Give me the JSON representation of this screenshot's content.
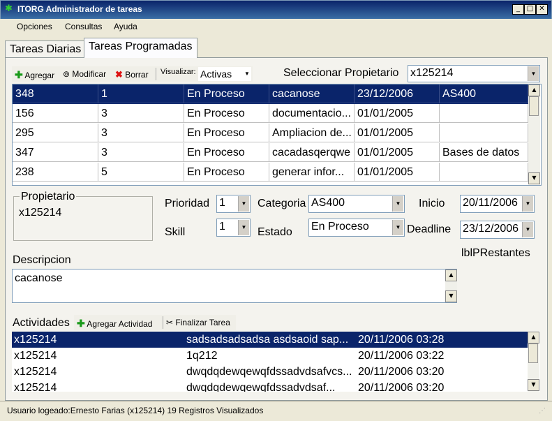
{
  "window": {
    "title": "ITORG Administrador de tareas"
  },
  "menu": [
    "Opciones",
    "Consultas",
    "Ayuda"
  ],
  "tabs": [
    "Tareas Diarias",
    "Tareas Programadas"
  ],
  "toolbar": {
    "add_label": "Agregar",
    "edit_label": "Modificar",
    "delete_label": "Borrar",
    "view_label": "Visualizar:",
    "view_value": "Activas"
  },
  "owner_select": {
    "label": "Seleccionar Propietario",
    "value": "x125214"
  },
  "tasks": [
    {
      "id": "348",
      "prio": "1",
      "estado": "En Proceso",
      "desc": "cacanose",
      "fecha": "23/12/2006",
      "cat": "AS400"
    },
    {
      "id": "156",
      "prio": "3",
      "estado": "En Proceso",
      "desc": "documentacio...",
      "fecha": "01/01/2005",
      "cat": ""
    },
    {
      "id": "295",
      "prio": "3",
      "estado": "En Proceso",
      "desc": "Ampliacion de...",
      "fecha": "01/01/2005",
      "cat": ""
    },
    {
      "id": "347",
      "prio": "3",
      "estado": "En Proceso",
      "desc": "cacadasqerqwe",
      "fecha": "01/01/2005",
      "cat": "Bases de datos"
    },
    {
      "id": "238",
      "prio": "5",
      "estado": "En Proceso",
      "desc": "generar infor...",
      "fecha": "01/01/2005",
      "cat": ""
    }
  ],
  "details": {
    "owner_group": "Propietario",
    "owner_value": "x125214",
    "prioridad_label": "Prioridad",
    "prioridad": "1",
    "skill_label": "Skill",
    "skill": "1",
    "categoria_label": "Categoria",
    "categoria": "AS400",
    "estado_label": "Estado",
    "estado": "En Proceso",
    "inicio_label": "Inicio",
    "inicio": "20/11/2006",
    "deadline_label": "Deadline",
    "deadline": "23/12/2006",
    "restantes_label": "lblPRestantes",
    "desc_label": "Descripcion",
    "desc": "cacanose"
  },
  "activities": {
    "label": "Actividades",
    "add_label": "Agregar Actividad",
    "finish_label": "Finalizar Tarea",
    "rows": [
      {
        "user": "x125214",
        "text": "sadsadsadsadsa  asdsaoid sap...",
        "date": "20/11/2006 03:28"
      },
      {
        "user": "x125214",
        "text": "1q212",
        "date": "20/11/2006 03:22"
      },
      {
        "user": "x125214",
        "text": "dwqdqdewqewqfdssadvdsafvcs...",
        "date": "20/11/2006 03:20"
      },
      {
        "user": "x125214",
        "text": "dwqdqdewqewqfdssadvdsaf...",
        "date": "20/11/2006 03:20"
      }
    ]
  },
  "status": {
    "text": "Usuario logeado:Ernesto Farias (x125214)  19 Registros Visualizados"
  },
  "colors": {
    "selection": "#0a246a",
    "title_bar": "#0a246a"
  }
}
